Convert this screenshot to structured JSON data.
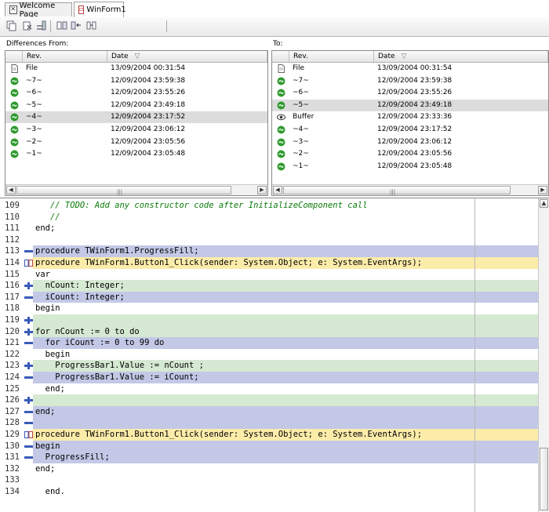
{
  "tabs": [
    {
      "label": "Welcome Page",
      "icon": "close-x-icon",
      "active": false
    },
    {
      "label": "WinForm1",
      "icon": "form-icon",
      "active": true
    }
  ],
  "toolbar": {
    "buttons": [
      "copy-icon",
      "delete-icon",
      "merge-icon",
      "diff-prev-icon",
      "diff-next-icon",
      "diff-sync-icon"
    ]
  },
  "left_panel": {
    "label": "Differences From:",
    "columns": [
      "Rev.",
      "Date"
    ],
    "rows": [
      {
        "icon": "file-icon",
        "rev": "File",
        "date": "13/09/2004 00:31:54",
        "selected": false
      },
      {
        "icon": "revision-icon",
        "rev": "~7~",
        "date": "12/09/2004 23:59:38",
        "selected": false
      },
      {
        "icon": "revision-icon",
        "rev": "~6~",
        "date": "12/09/2004 23:55:26",
        "selected": false
      },
      {
        "icon": "revision-icon",
        "rev": "~5~",
        "date": "12/09/2004 23:49:18",
        "selected": false
      },
      {
        "icon": "revision-icon",
        "rev": "~4~",
        "date": "12/09/2004 23:17:52",
        "selected": true
      },
      {
        "icon": "revision-icon",
        "rev": "~3~",
        "date": "12/09/2004 23:06:12",
        "selected": false
      },
      {
        "icon": "revision-icon",
        "rev": "~2~",
        "date": "12/09/2004 23:05:56",
        "selected": false
      },
      {
        "icon": "revision-icon",
        "rev": "~1~",
        "date": "12/09/2004 23:05:48",
        "selected": false
      }
    ]
  },
  "right_panel": {
    "label": "To:",
    "columns": [
      "Rev.",
      "Date"
    ],
    "rows": [
      {
        "icon": "file-icon",
        "rev": "File",
        "date": "13/09/2004 00:31:54",
        "selected": false
      },
      {
        "icon": "revision-icon",
        "rev": "~7~",
        "date": "12/09/2004 23:59:38",
        "selected": false
      },
      {
        "icon": "revision-icon",
        "rev": "~6~",
        "date": "12/09/2004 23:55:26",
        "selected": false
      },
      {
        "icon": "revision-icon",
        "rev": "~5~",
        "date": "12/09/2004 23:49:18",
        "selected": true
      },
      {
        "icon": "buffer-eye-icon",
        "rev": "Buffer",
        "date": "12/09/2004 23:33:36",
        "selected": false
      },
      {
        "icon": "revision-icon",
        "rev": "~4~",
        "date": "12/09/2004 23:17:52",
        "selected": false
      },
      {
        "icon": "revision-icon",
        "rev": "~3~",
        "date": "12/09/2004 23:06:12",
        "selected": false
      },
      {
        "icon": "revision-icon",
        "rev": "~2~",
        "date": "12/09/2004 23:05:56",
        "selected": false
      },
      {
        "icon": "revision-icon",
        "rev": "~1~",
        "date": "12/09/2004 23:05:48",
        "selected": false
      }
    ]
  },
  "code": {
    "lines": [
      {
        "num": "109",
        "marker": "",
        "bg": "none",
        "text": "   // TODO: Add any constructor code after InitializeComponent call",
        "comment": true
      },
      {
        "num": "110",
        "marker": "",
        "bg": "none",
        "text": "   //",
        "comment": true
      },
      {
        "num": "111",
        "marker": "",
        "bg": "none",
        "text": "end;",
        "comment": false
      },
      {
        "num": "112",
        "marker": "",
        "bg": "none",
        "text": "",
        "comment": false
      },
      {
        "num": "113",
        "marker": "minus",
        "bg": "blue",
        "text": "procedure TWinForm1.ProgressFill;",
        "comment": false
      },
      {
        "num": "114",
        "marker": "change",
        "bg": "yellow",
        "text": "procedure TWinForm1.Button1_Click(sender: System.Object; e: System.EventArgs);",
        "comment": false
      },
      {
        "num": "115",
        "marker": "",
        "bg": "none",
        "text": "var",
        "comment": false
      },
      {
        "num": "116",
        "marker": "plus",
        "bg": "green",
        "text": "  nCount: Integer;",
        "comment": false
      },
      {
        "num": "117",
        "marker": "minus",
        "bg": "blue",
        "text": "  iCount: Integer;",
        "comment": false
      },
      {
        "num": "118",
        "marker": "",
        "bg": "none",
        "text": "begin",
        "comment": false
      },
      {
        "num": "119",
        "marker": "plus",
        "bg": "green",
        "text": "",
        "comment": false
      },
      {
        "num": "120",
        "marker": "plus",
        "bg": "green",
        "text": "for nCount := 0 to do",
        "comment": false
      },
      {
        "num": "121",
        "marker": "minus",
        "bg": "blue",
        "text": "  for iCount := 0 to 99 do",
        "comment": false
      },
      {
        "num": "122",
        "marker": "",
        "bg": "none",
        "text": "  begin",
        "comment": false
      },
      {
        "num": "123",
        "marker": "plus",
        "bg": "green",
        "text": "    ProgressBar1.Value := nCount ;",
        "comment": false
      },
      {
        "num": "124",
        "marker": "minus",
        "bg": "blue",
        "text": "    ProgressBar1.Value := iCount;",
        "comment": false
      },
      {
        "num": "125",
        "marker": "",
        "bg": "none",
        "text": "  end;",
        "comment": false
      },
      {
        "num": "126",
        "marker": "plus",
        "bg": "green",
        "text": "",
        "comment": false
      },
      {
        "num": "127",
        "marker": "minus",
        "bg": "blue",
        "text": "end;",
        "comment": false
      },
      {
        "num": "128",
        "marker": "minus",
        "bg": "blue",
        "text": "",
        "comment": false
      },
      {
        "num": "129",
        "marker": "change",
        "bg": "yellow",
        "text": "procedure TWinForm1.Button1_Click(sender: System.Object; e: System.EventArgs);",
        "comment": false
      },
      {
        "num": "130",
        "marker": "minus",
        "bg": "blue",
        "text": "begin",
        "comment": false
      },
      {
        "num": "131",
        "marker": "minus",
        "bg": "blue",
        "text": "  ProgressFill;",
        "comment": false
      },
      {
        "num": "132",
        "marker": "",
        "bg": "none",
        "text": "end;",
        "comment": false
      },
      {
        "num": "133",
        "marker": "",
        "bg": "none",
        "text": "",
        "comment": false
      },
      {
        "num": "134",
        "marker": "",
        "bg": "none",
        "text": "  end.",
        "comment": false
      }
    ]
  },
  "colors": {
    "deleted_bg": "#c2c8e6",
    "added_bg": "#d6e9d2",
    "changed_bg": "#fcecaa",
    "revision_icon": "#2e9a2e",
    "marker": "#3a5bb8"
  }
}
